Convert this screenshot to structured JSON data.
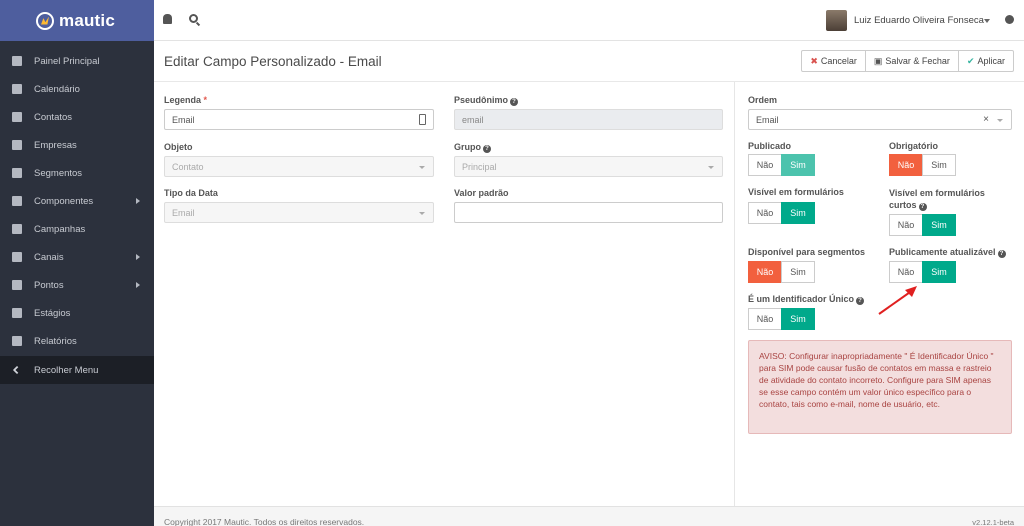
{
  "app": {
    "brand": "mautic"
  },
  "sidebar": {
    "items": [
      {
        "label": "Painel Principal",
        "icon": "grid-icon",
        "submenu": false
      },
      {
        "label": "Calendário",
        "icon": "calendar-icon",
        "submenu": false
      },
      {
        "label": "Contatos",
        "icon": "user-icon",
        "submenu": false
      },
      {
        "label": "Empresas",
        "icon": "building-icon",
        "submenu": false
      },
      {
        "label": "Segmentos",
        "icon": "pie-chart-icon",
        "submenu": false
      },
      {
        "label": "Componentes",
        "icon": "puzzle-icon",
        "submenu": true
      },
      {
        "label": "Campanhas",
        "icon": "clock-icon",
        "submenu": false
      },
      {
        "label": "Canais",
        "icon": "rss-icon",
        "submenu": true
      },
      {
        "label": "Pontos",
        "icon": "calculator-icon",
        "submenu": true
      },
      {
        "label": "Estágios",
        "icon": "cubes-icon",
        "submenu": false
      },
      {
        "label": "Relatórios",
        "icon": "line-chart-icon",
        "submenu": false
      }
    ],
    "collapse_label": "Recolher Menu"
  },
  "header": {
    "user_name": "Luiz Eduardo Oliveira Fonseca"
  },
  "page": {
    "title": "Editar Campo Personalizado - Email",
    "buttons": {
      "cancel": "Cancelar",
      "save_close": "Salvar & Fechar",
      "apply": "Aplicar"
    }
  },
  "form": {
    "legend": {
      "label": "Legenda",
      "required_mark": "*",
      "value": "Email"
    },
    "alias": {
      "label": "Pseudônimo",
      "value": "email"
    },
    "object": {
      "label": "Objeto",
      "value": "Contato"
    },
    "group": {
      "label": "Grupo",
      "value": "Principal"
    },
    "data_type": {
      "label": "Tipo da Data",
      "value": "Email"
    },
    "default_value": {
      "label": "Valor padrão",
      "value": ""
    }
  },
  "properties": {
    "order": {
      "label": "Ordem",
      "value": "Email",
      "clear": "×"
    },
    "no_label": "Não",
    "yes_label": "Sim",
    "published": {
      "label": "Publicado",
      "selected": "Sim"
    },
    "required": {
      "label": "Obrigatório",
      "selected": "Não"
    },
    "visible_forms": {
      "label": "Visível em formulários",
      "selected": "Sim"
    },
    "visible_short_forms": {
      "label_line1": "Visível em formulários",
      "label_line2": "curtos",
      "selected": "Sim"
    },
    "available_segments": {
      "label": "Disponível para segmentos",
      "selected": "Não"
    },
    "publicly_updatable": {
      "label": "Publicamente atualizável",
      "selected": "Sim"
    },
    "unique_identifier": {
      "label": "É um Identificador Único",
      "selected": "Sim"
    },
    "warning": "AVISO: Configurar inapropriadamente \" É Identificador Único \" para SIM pode causar fusão de contatos em massa e rastreio de atividade do contato incorreto. Configure para SIM apenas se esse campo contém um valor único específico para o contato, tais como e-mail, nome de usuário, etc."
  },
  "footer": {
    "copyright": "Copyright 2017 Mautic. Todos os direitos reservados.",
    "version": "v2.12.1-beta"
  },
  "colors": {
    "sidebar_bg": "#2c313d",
    "brand_bg": "#4e5e9e",
    "toggle_on": "#00a98b",
    "toggle_on_light": "#4cc3ad",
    "toggle_no": "#f2603e",
    "warning_bg": "#f3dede"
  }
}
